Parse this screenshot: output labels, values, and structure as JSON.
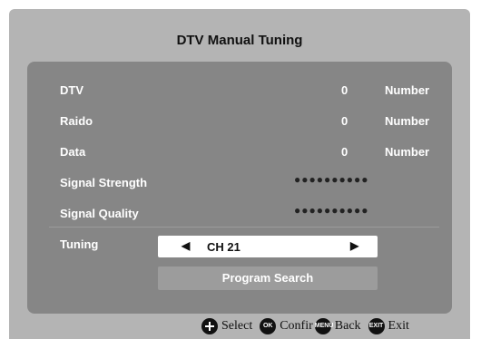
{
  "window": {
    "title": "DTV Manual Tuning"
  },
  "rows": [
    {
      "label": "DTV",
      "value": "0",
      "unit": "Number"
    },
    {
      "label": "Raido",
      "value": "0",
      "unit": "Number"
    },
    {
      "label": "Data",
      "value": "0",
      "unit": "Number"
    }
  ],
  "signal": {
    "strength_label": "Signal Strength",
    "strength_value": "●●●●●●●●●●",
    "quality_label": "Signal Quality",
    "quality_value": "●●●●●●●●●●"
  },
  "tuning": {
    "label": "Tuning",
    "channel": "CH 21",
    "left_arrow": "◀",
    "right_arrow": "▶"
  },
  "program_search": {
    "label": "Program Search"
  },
  "footer": {
    "select_icon": "dpad-icon",
    "select": "Select",
    "ok_icon_text": "OK",
    "confirm": "Confir",
    "menu_icon_text": "MENU",
    "back": "Back",
    "exit_icon_text": "EXIT",
    "exit": "Exit"
  }
}
